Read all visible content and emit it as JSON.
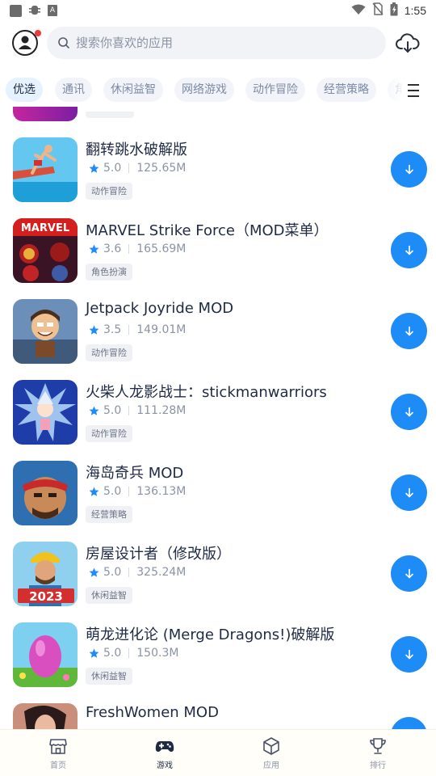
{
  "status_bar": {
    "time": "1:55",
    "left_icons": [
      "gallery-icon",
      "bug-icon",
      "text-icon"
    ],
    "right_icons": [
      "wifi-icon",
      "no-sim-icon",
      "battery-charging-icon"
    ]
  },
  "header": {
    "search_placeholder": "搜索你喜欢的应用",
    "has_notification_dot": true
  },
  "tabs": [
    "优选",
    "通讯",
    "休闲益智",
    "网络游戏",
    "动作冒险",
    "经营策略",
    "角"
  ],
  "active_tab": 0,
  "apps": [
    {
      "name": "翻转跳水破解版",
      "rating": "5.0",
      "size": "125.65M",
      "category": "动作冒险"
    },
    {
      "name": "MARVEL Strike Force（MOD菜单）",
      "rating": "3.6",
      "size": "165.69M",
      "category": "角色扮演"
    },
    {
      "name": "Jetpack Joyride MOD",
      "rating": "3.5",
      "size": "149.01M",
      "category": "动作冒险"
    },
    {
      "name": "火柴人龙影战士：stickmanwarriors",
      "rating": "5.0",
      "size": "111.28M",
      "category": "动作冒险"
    },
    {
      "name": "海岛奇兵 MOD",
      "rating": "5.0",
      "size": "136.13M",
      "category": "经营策略"
    },
    {
      "name": "房屋设计者（修改版）",
      "rating": "5.0",
      "size": "325.24M",
      "category": "休闲益智"
    },
    {
      "name": "萌龙进化论 (Merge Dragons!)破解版",
      "rating": "5.0",
      "size": "150.3M",
      "category": "休闲益智"
    },
    {
      "name": "FreshWomen MOD",
      "rating": "",
      "size": "",
      "category": ""
    }
  ],
  "app_icon_text": {
    "marvel": "MARVEL",
    "year": "2023"
  },
  "bottom_nav": [
    {
      "label": "首页",
      "icon": "store-icon"
    },
    {
      "label": "游戏",
      "icon": "gamepad-icon"
    },
    {
      "label": "应用",
      "icon": "cube-icon"
    },
    {
      "label": "排行",
      "icon": "trophy-icon"
    }
  ],
  "active_nav": 1,
  "colors": {
    "accent": "#1e8cf7",
    "active_tab_bg": "#e6f2ff",
    "tag_bg": "#f0f1f5",
    "notification_dot": "#f03838"
  }
}
